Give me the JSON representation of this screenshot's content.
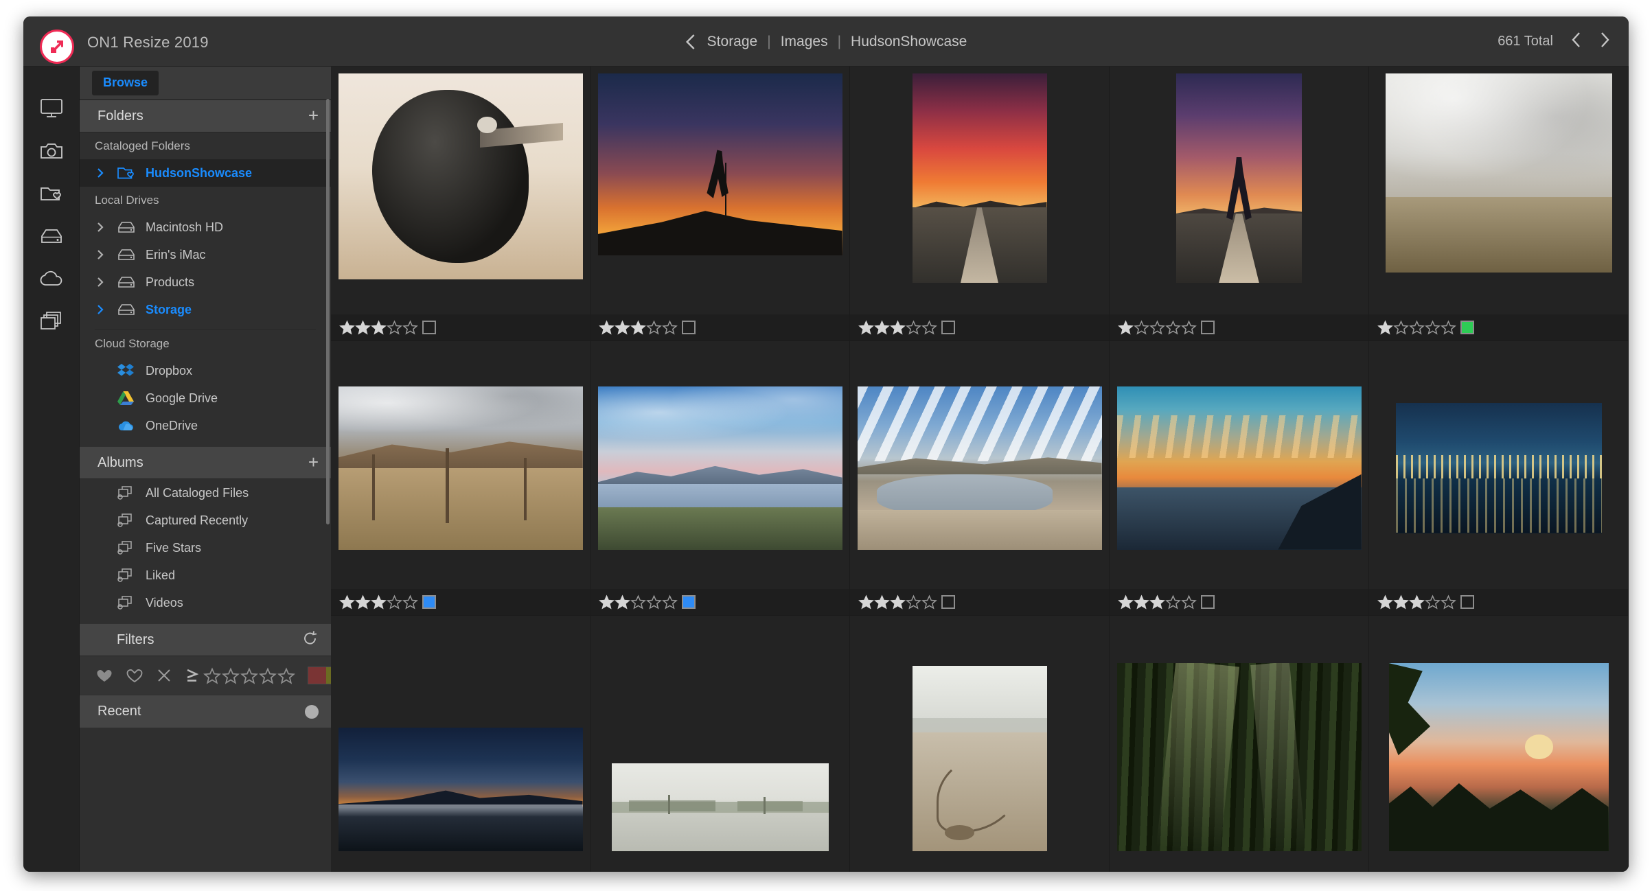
{
  "window": {
    "app_title": "ON1 Resize 2019",
    "logo_icon": "resize-arrow-icon",
    "accent_color": "#1a8cff",
    "brand_color": "#ef2b55"
  },
  "header": {
    "back_icon": "chevron-left-icon",
    "breadcrumb": [
      "Storage",
      "Images",
      "HudsonShowcase"
    ],
    "separator": "|",
    "counter": "661 Total",
    "prev_icon": "chevron-left-icon",
    "next_icon": "chevron-right-icon"
  },
  "icon_rail": [
    {
      "name": "browse-module",
      "icon": "monitor-icon"
    },
    {
      "name": "camera-module",
      "icon": "camera-icon"
    },
    {
      "name": "cataloged-folders-module",
      "icon": "folder-heart-icon"
    },
    {
      "name": "local-drives-module",
      "icon": "hard-drive-icon"
    },
    {
      "name": "cloud-storage-module",
      "icon": "cloud-icon"
    },
    {
      "name": "albums-module",
      "icon": "layers-stack-icon"
    }
  ],
  "sidebar": {
    "browse_tab": "Browse",
    "folders_panel": {
      "title": "Folders",
      "add_icon": "plus-icon",
      "groups": [
        {
          "label": "Cataloged Folders",
          "items": [
            {
              "label": "HudsonShowcase",
              "icon": "folder-heart-icon",
              "chevron": "chevron-right-icon",
              "selected": true
            }
          ]
        },
        {
          "label": "Local Drives",
          "items": [
            {
              "label": "Macintosh HD",
              "icon": "hard-drive-icon",
              "chevron": "chevron-right-icon",
              "selected": false
            },
            {
              "label": "Erin's iMac",
              "icon": "hard-drive-icon",
              "chevron": "chevron-right-icon",
              "selected": false
            },
            {
              "label": "Products",
              "icon": "hard-drive-icon",
              "chevron": "chevron-right-icon",
              "selected": false
            },
            {
              "label": "Storage",
              "icon": "hard-drive-icon",
              "chevron": "chevron-right-icon",
              "selected": true
            }
          ]
        },
        {
          "label": "Cloud Storage",
          "items": [
            {
              "label": "Dropbox",
              "icon": "dropbox-icon"
            },
            {
              "label": "Google Drive",
              "icon": "google-drive-icon"
            },
            {
              "label": "OneDrive",
              "icon": "onedrive-icon"
            }
          ]
        }
      ]
    },
    "albums_panel": {
      "title": "Albums",
      "add_icon": "plus-icon",
      "items": [
        {
          "label": "All Cataloged Files",
          "icon": "album-stack-icon"
        },
        {
          "label": "Captured Recently",
          "icon": "album-stack-icon"
        },
        {
          "label": "Five Stars",
          "icon": "album-stack-icon"
        },
        {
          "label": "Liked",
          "icon": "album-stack-icon"
        },
        {
          "label": "Videos",
          "icon": "album-stack-icon"
        }
      ]
    },
    "filters_panel": {
      "title": "Filters",
      "reset_icon": "reset-arrow-icon",
      "glyphs": [
        {
          "name": "liked-filter",
          "icon": "heart-filled-icon"
        },
        {
          "name": "not-liked-filter",
          "icon": "heart-outline-icon"
        },
        {
          "name": "rejected-filter",
          "icon": "x-icon"
        },
        {
          "name": "rating-comparator",
          "icon": "greater-than-or-equal-icon"
        }
      ],
      "star_count": 5,
      "stars_filled": 0,
      "color_swatches": [
        "#7a3434",
        "#6b6b22",
        "#2f6b36",
        "#2f4a74",
        "#4a3474",
        "#4f4f4f"
      ]
    },
    "recent_panel": {
      "title": "Recent",
      "indicator_icon": "circle-icon"
    }
  },
  "grid": {
    "rows": [
      [
        {
          "name": "raven-portrait",
          "rating": 3,
          "color_label": "",
          "orientation": "landscape"
        },
        {
          "name": "hiker-silhouette-sunset",
          "rating": 3,
          "color_label": "",
          "orientation": "landscape"
        },
        {
          "name": "desert-road-sunset",
          "rating": 3,
          "color_label": "",
          "orientation": "portrait"
        },
        {
          "name": "woman-on-road-sunset",
          "rating": 1,
          "color_label": "",
          "orientation": "portrait"
        },
        {
          "name": "field-overcast-sky",
          "rating": 1,
          "color_label": "#2ecc55",
          "orientation": "landscape"
        }
      ],
      [
        {
          "name": "desert-fence-hills",
          "rating": 3,
          "color_label": "#2e8bf5",
          "orientation": "landscape"
        },
        {
          "name": "mountain-lake-sunrise",
          "rating": 2,
          "color_label": "#2e8bf5",
          "orientation": "landscape"
        },
        {
          "name": "cloud-reflection-beach",
          "rating": 3,
          "color_label": "",
          "orientation": "landscape"
        },
        {
          "name": "coastal-sunset-bay",
          "rating": 3,
          "color_label": "",
          "orientation": "landscape"
        },
        {
          "name": "city-lights-night",
          "rating": 3,
          "color_label": "",
          "orientation": "landscape"
        }
      ],
      [
        {
          "name": "mount-hood-blue-hour",
          "rating": 0,
          "color_label": "",
          "orientation": "landscape"
        },
        {
          "name": "foggy-lake-minimal",
          "rating": 0,
          "color_label": "",
          "orientation": "landscape"
        },
        {
          "name": "beach-rope-fog",
          "rating": 0,
          "color_label": "",
          "orientation": "portrait"
        },
        {
          "name": "redwood-forest-sunbeams",
          "rating": 0,
          "color_label": "",
          "orientation": "landscape"
        },
        {
          "name": "pine-sunset-silhouette",
          "rating": 0,
          "color_label": "",
          "orientation": "landscape"
        }
      ]
    ]
  }
}
